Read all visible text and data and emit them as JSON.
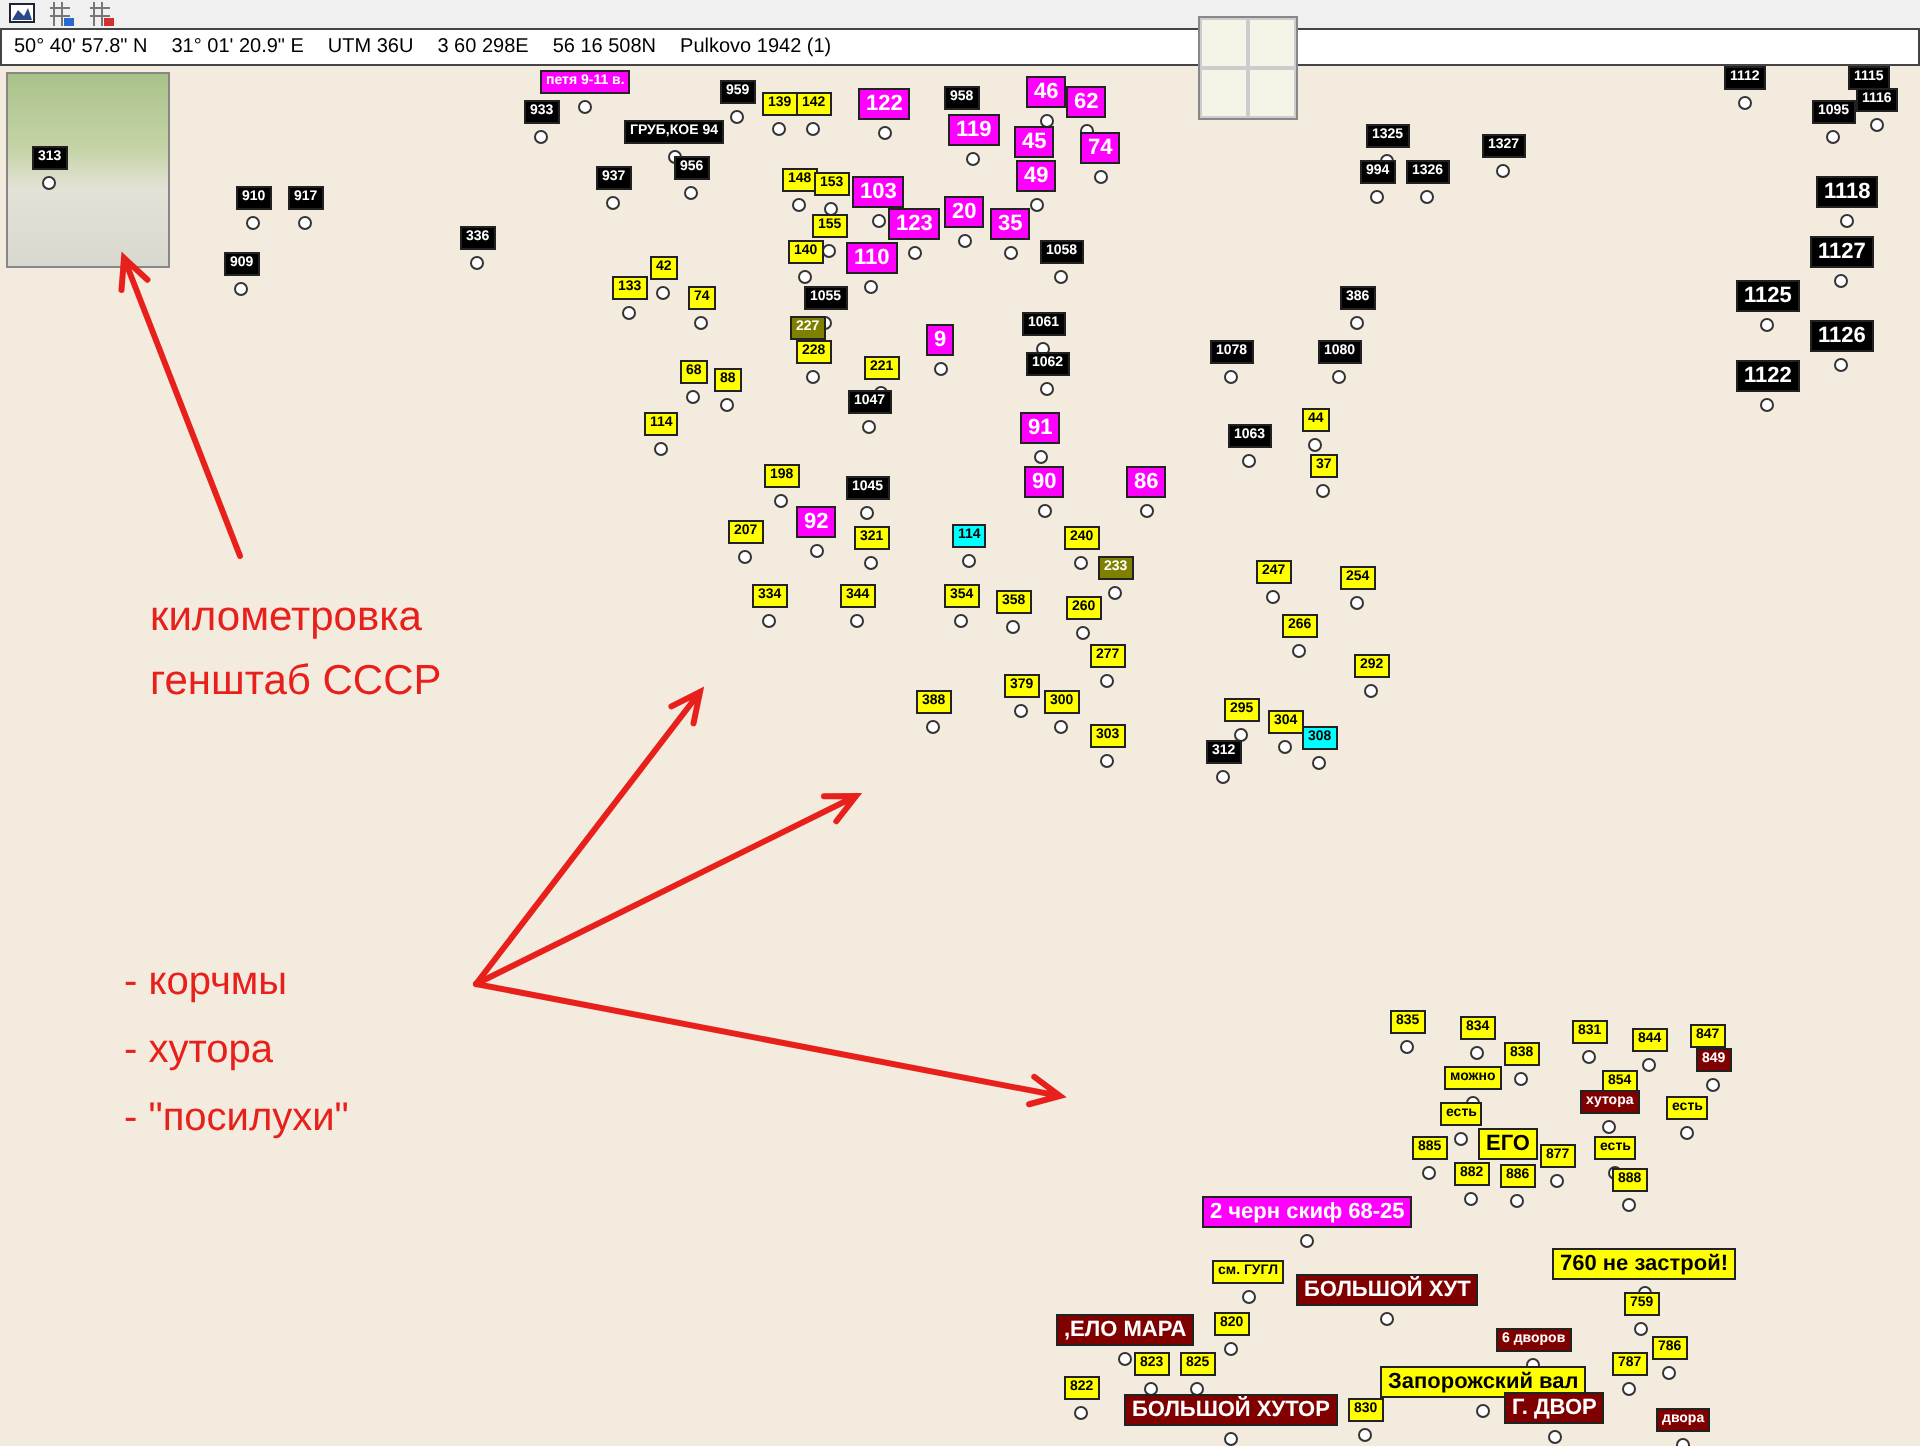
{
  "toolbar": {
    "buttons": [
      {
        "kind": "map"
      },
      {
        "kind": "grid-s"
      },
      {
        "kind": "grid-g"
      }
    ]
  },
  "coordinates": {
    "lat": "50° 40' 57.8\" N",
    "lon": "31° 01' 20.9\" E",
    "zone": "UTM  36U",
    "easting": "3 60 298E",
    "northing": "56 16 508N",
    "datum": "Pulkovo 1942 (1)"
  },
  "annotations": {
    "caption": [
      "километровка",
      "генштаб СССР"
    ],
    "list": [
      "- корчмы",
      "- хутора",
      "- \"посилухи\""
    ]
  },
  "waypoints": [
    {
      "label": "313",
      "color": "#000000",
      "kind": "small"
    },
    {
      "label": "910",
      "color": "#000000",
      "kind": "small"
    },
    {
      "label": "917",
      "color": "#000000",
      "kind": "small"
    },
    {
      "label": "909",
      "color": "#000000",
      "kind": "small"
    },
    {
      "label": "933",
      "color": "#000000",
      "kind": "small"
    },
    {
      "label": "336",
      "color": "#000000",
      "kind": "small"
    },
    {
      "label": "937",
      "color": "#000000",
      "kind": "small"
    },
    {
      "label": "ГРУБ,КОЕ 94",
      "color": "#000000",
      "kind": "small"
    },
    {
      "label": "956",
      "color": "#000000",
      "kind": "small"
    },
    {
      "label": "959",
      "color": "#000000",
      "kind": "small"
    },
    {
      "label": "958",
      "color": "#000000",
      "kind": "small"
    },
    {
      "label": "петя 9-11 в.",
      "color": "#ff00ff",
      "kind": "small"
    },
    {
      "label": "122",
      "color": "#ff00ff",
      "kind": "large"
    },
    {
      "label": "119",
      "color": "#ff00ff",
      "kind": "large"
    },
    {
      "label": "46",
      "color": "#ff00ff",
      "kind": "large"
    },
    {
      "label": "62",
      "color": "#ff00ff",
      "kind": "large"
    },
    {
      "label": "45",
      "color": "#ff00ff",
      "kind": "large"
    },
    {
      "label": "74",
      "color": "#ff00ff",
      "kind": "large"
    },
    {
      "label": "49",
      "color": "#ff00ff",
      "kind": "large"
    },
    {
      "label": "103",
      "color": "#ff00ff",
      "kind": "large"
    },
    {
      "label": "123",
      "color": "#ff00ff",
      "kind": "large"
    },
    {
      "label": "20",
      "color": "#ff00ff",
      "kind": "large"
    },
    {
      "label": "110",
      "color": "#ff00ff",
      "kind": "large"
    },
    {
      "label": "35",
      "color": "#ff00ff",
      "kind": "large"
    },
    {
      "label": "1058",
      "color": "#000000",
      "kind": "small"
    },
    {
      "label": "139",
      "color": "#ffff00",
      "kind": "small"
    },
    {
      "label": "142",
      "color": "#ffff00",
      "kind": "small"
    },
    {
      "label": "148",
      "color": "#ffff00",
      "kind": "small"
    },
    {
      "label": "153",
      "color": "#ffff00",
      "kind": "small"
    },
    {
      "label": "155",
      "color": "#ffff00",
      "kind": "small"
    },
    {
      "label": "140",
      "color": "#ffff00",
      "kind": "small"
    },
    {
      "label": "42",
      "color": "#ffff00",
      "kind": "small"
    },
    {
      "label": "133",
      "color": "#ffff00",
      "kind": "small"
    },
    {
      "label": "74",
      "color": "#ffff00",
      "kind": "small"
    },
    {
      "label": "1055",
      "color": "#000000",
      "kind": "small"
    },
    {
      "label": "227",
      "color": "#808000",
      "kind": "small"
    },
    {
      "label": "228",
      "color": "#ffff00",
      "kind": "small"
    },
    {
      "label": "221",
      "color": "#ffff00",
      "kind": "small"
    },
    {
      "label": "68",
      "color": "#ffff00",
      "kind": "small"
    },
    {
      "label": "88",
      "color": "#ffff00",
      "kind": "small"
    },
    {
      "label": "114",
      "color": "#ffff00",
      "kind": "small"
    },
    {
      "label": "9",
      "color": "#ff00ff",
      "kind": "large"
    },
    {
      "label": "1061",
      "color": "#000000",
      "kind": "small"
    },
    {
      "label": "1062",
      "color": "#000000",
      "kind": "small"
    },
    {
      "label": "1047",
      "color": "#000000",
      "kind": "small"
    },
    {
      "label": "1045",
      "color": "#000000",
      "kind": "small"
    },
    {
      "label": "91",
      "color": "#ff00ff",
      "kind": "large"
    },
    {
      "label": "90",
      "color": "#ff00ff",
      "kind": "large"
    },
    {
      "label": "86",
      "color": "#ff00ff",
      "kind": "large"
    },
    {
      "label": "92",
      "color": "#ff00ff",
      "kind": "large"
    },
    {
      "label": "198",
      "color": "#ffff00",
      "kind": "small"
    },
    {
      "label": "207",
      "color": "#ffff00",
      "kind": "small"
    },
    {
      "label": "321",
      "color": "#ffff00",
      "kind": "small"
    },
    {
      "label": "114",
      "color": "#00ffff",
      "kind": "small"
    },
    {
      "label": "334",
      "color": "#ffff00",
      "kind": "small"
    },
    {
      "label": "344",
      "color": "#ffff00",
      "kind": "small"
    },
    {
      "label": "354",
      "color": "#ffff00",
      "kind": "small"
    },
    {
      "label": "358",
      "color": "#ffff00",
      "kind": "small"
    },
    {
      "label": "240",
      "color": "#ffff00",
      "kind": "small"
    },
    {
      "label": "233",
      "color": "#808000",
      "kind": "small"
    },
    {
      "label": "260",
      "color": "#ffff00",
      "kind": "small"
    },
    {
      "label": "277",
      "color": "#ffff00",
      "kind": "small"
    },
    {
      "label": "379",
      "color": "#ffff00",
      "kind": "small"
    },
    {
      "label": "388",
      "color": "#ffff00",
      "kind": "small"
    },
    {
      "label": "300",
      "color": "#ffff00",
      "kind": "small"
    },
    {
      "label": "303",
      "color": "#ffff00",
      "kind": "small"
    },
    {
      "label": "1078",
      "color": "#000000",
      "kind": "small"
    },
    {
      "label": "1080",
      "color": "#000000",
      "kind": "small"
    },
    {
      "label": "386",
      "color": "#000000",
      "kind": "small"
    },
    {
      "label": "1063",
      "color": "#000000",
      "kind": "small"
    },
    {
      "label": "44",
      "color": "#ffff00",
      "kind": "small"
    },
    {
      "label": "37",
      "color": "#ffff00",
      "kind": "small"
    },
    {
      "label": "247",
      "color": "#ffff00",
      "kind": "small"
    },
    {
      "label": "254",
      "color": "#ffff00",
      "kind": "small"
    },
    {
      "label": "266",
      "color": "#ffff00",
      "kind": "small"
    },
    {
      "label": "292",
      "color": "#ffff00",
      "kind": "small"
    },
    {
      "label": "295",
      "color": "#ffff00",
      "kind": "small"
    },
    {
      "label": "304",
      "color": "#ffff00",
      "kind": "small"
    },
    {
      "label": "308",
      "color": "#00ffff",
      "kind": "small"
    },
    {
      "label": "312",
      "color": "#000000",
      "kind": "small"
    },
    {
      "label": "1325",
      "color": "#000000",
      "kind": "small"
    },
    {
      "label": "994",
      "color": "#000000",
      "kind": "small"
    },
    {
      "label": "1326",
      "color": "#000000",
      "kind": "small"
    },
    {
      "label": "1327",
      "color": "#000000",
      "kind": "small"
    },
    {
      "label": "1112",
      "color": "#000000",
      "kind": "small"
    },
    {
      "label": "1115",
      "color": "#000000",
      "kind": "small"
    },
    {
      "label": "1116",
      "color": "#000000",
      "kind": "small"
    },
    {
      "label": "1095",
      "color": "#000000",
      "kind": "small"
    },
    {
      "label": "1118",
      "color": "#000000",
      "kind": "large"
    },
    {
      "label": "1127",
      "color": "#000000",
      "kind": "large"
    },
    {
      "label": "1125",
      "color": "#000000",
      "kind": "large"
    },
    {
      "label": "1126",
      "color": "#000000",
      "kind": "large"
    },
    {
      "label": "1122",
      "color": "#000000",
      "kind": "large"
    },
    {
      "label": "835",
      "color": "#ffff00",
      "kind": "small"
    },
    {
      "label": "834",
      "color": "#ffff00",
      "kind": "small"
    },
    {
      "label": "838",
      "color": "#ffff00",
      "kind": "small"
    },
    {
      "label": "831",
      "color": "#ffff00",
      "kind": "small"
    },
    {
      "label": "844",
      "color": "#ffff00",
      "kind": "small"
    },
    {
      "label": "847",
      "color": "#ffff00",
      "kind": "small"
    },
    {
      "label": "849",
      "color": "#800000",
      "kind": "small"
    },
    {
      "label": "можно",
      "color": "#ffff00",
      "kind": "small"
    },
    {
      "label": "854",
      "color": "#ffff00",
      "kind": "small"
    },
    {
      "label": "хутора",
      "color": "#800000",
      "kind": "small"
    },
    {
      "label": "есть",
      "color": "#ffff00",
      "kind": "small"
    },
    {
      "label": "есть",
      "color": "#ffff00",
      "kind": "small"
    },
    {
      "label": "885",
      "color": "#ffff00",
      "kind": "small"
    },
    {
      "label": "ЕГО",
      "color": "#ffff00",
      "kind": "large"
    },
    {
      "label": "877",
      "color": "#ffff00",
      "kind": "small"
    },
    {
      "label": "есть",
      "color": "#ffff00",
      "kind": "small"
    },
    {
      "label": "882",
      "color": "#ffff00",
      "kind": "small"
    },
    {
      "label": "886",
      "color": "#ffff00",
      "kind": "small"
    },
    {
      "label": "888",
      "color": "#ffff00",
      "kind": "small"
    },
    {
      "label": "2 черн скиф 68-25",
      "color": "#ff00ff",
      "kind": "large"
    },
    {
      "label": "см. ГУГЛ",
      "color": "#ffff00",
      "kind": "small"
    },
    {
      "label": "БОЛЬШОЙ ХУТ",
      "color": "#800000",
      "kind": "large"
    },
    {
      "label": "760 не застрой!",
      "color": "#ffff00",
      "kind": "large"
    },
    {
      "label": "759",
      "color": "#ffff00",
      "kind": "small"
    },
    {
      "label": ",ЕЛО МАРА",
      "color": "#800000",
      "kind": "large"
    },
    {
      "label": "820",
      "color": "#ffff00",
      "kind": "small"
    },
    {
      "label": "6 дворов",
      "color": "#800000",
      "kind": "small"
    },
    {
      "label": "786",
      "color": "#ffff00",
      "kind": "small"
    },
    {
      "label": "787",
      "color": "#ffff00",
      "kind": "small"
    },
    {
      "label": "822",
      "color": "#ffff00",
      "kind": "small"
    },
    {
      "label": "823",
      "color": "#ffff00",
      "kind": "small"
    },
    {
      "label": "825",
      "color": "#ffff00",
      "kind": "small"
    },
    {
      "label": "Запорожский вал",
      "color": "#ffff00",
      "kind": "large"
    },
    {
      "label": "БОЛЬШОЙ ХУТОР",
      "color": "#800000",
      "kind": "large"
    },
    {
      "label": "830",
      "color": "#ffff00",
      "kind": "small"
    },
    {
      "label": "Г. ДВОР",
      "color": "#800000",
      "kind": "large"
    },
    {
      "label": "двора",
      "color": "#800000",
      "kind": "small"
    }
  ]
}
